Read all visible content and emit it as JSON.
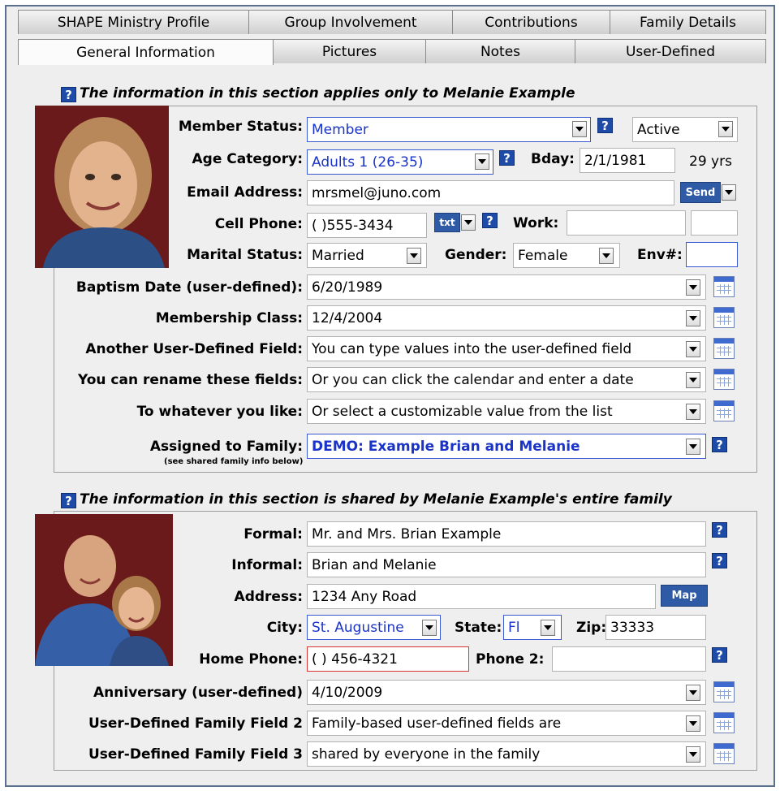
{
  "tabs_top": [
    "SHAPE Ministry Profile",
    "Group Involvement",
    "Contributions",
    "Family Details"
  ],
  "tabs_bottom": [
    "General Information",
    "Pictures",
    "Notes",
    "User-Defined"
  ],
  "personal": {
    "title": "The information in this section applies only to Melanie Example",
    "member_status_label": "Member Status:",
    "member_status": "Member",
    "activity": "Active",
    "age_category_label": "Age Category:",
    "age_category": "Adults 1 (26-35)",
    "bday_label": "Bday:",
    "bday": "2/1/1981",
    "age": "29 yrs",
    "email_label": "Email Address:",
    "email": "mrsmel@juno.com",
    "send_label": "Send",
    "cell_label": "Cell Phone:",
    "cell": "(   )555-3434",
    "txt_label": "txt",
    "work_label": "Work:",
    "work": "",
    "work_ext": "",
    "marital_label": "Marital Status:",
    "marital": "Married",
    "gender_label": "Gender:",
    "gender": "Female",
    "env_label": "Env#:",
    "env": "",
    "baptism_label": "Baptism Date (user-defined):",
    "baptism": "6/20/1989",
    "membership_label": "Membership Class:",
    "membership": "12/4/2004",
    "another_label": "Another User-Defined Field:",
    "another": "You can type values into the user-defined field",
    "rename_label": "You can rename these fields:",
    "rename": "Or you can click the calendar and enter a date",
    "whatever_label": "To whatever you like:",
    "whatever": "Or select a customizable value from the list",
    "family_label": "Assigned to Family:",
    "family_sub": "(see shared family info below)",
    "family": "DEMO: Example Brian and Melanie"
  },
  "family_section": {
    "title": "The information in this section is shared by Melanie Example's entire family",
    "formal_label": "Formal:",
    "formal": "Mr. and Mrs. Brian Example",
    "informal_label": "Informal:",
    "informal": "Brian and Melanie",
    "address_label": "Address:",
    "address": "1234 Any Road",
    "map_label": "Map",
    "city_label": "City:",
    "city": "St. Augustine",
    "state_label": "State:",
    "state": "Fl",
    "zip_label": "Zip:",
    "zip": "33333",
    "home_phone_label": "Home Phone:",
    "home_phone": "(   ) 456-4321",
    "phone2_label": "Phone 2:",
    "phone2": "",
    "anniv_label": "Anniversary (user-defined)",
    "anniv": "4/10/2009",
    "udf2_label": "User-Defined Family Field 2",
    "udf2": "Family-based user-defined fields are",
    "udf3_label": "User-Defined Family Field 3",
    "udf3": "shared by everyone in the family"
  },
  "colors": {
    "help_icon": "#1e4ba8",
    "accent_blue": "#3a59d6",
    "button_blue": "#2f5aa6",
    "error_border": "#d83434"
  }
}
